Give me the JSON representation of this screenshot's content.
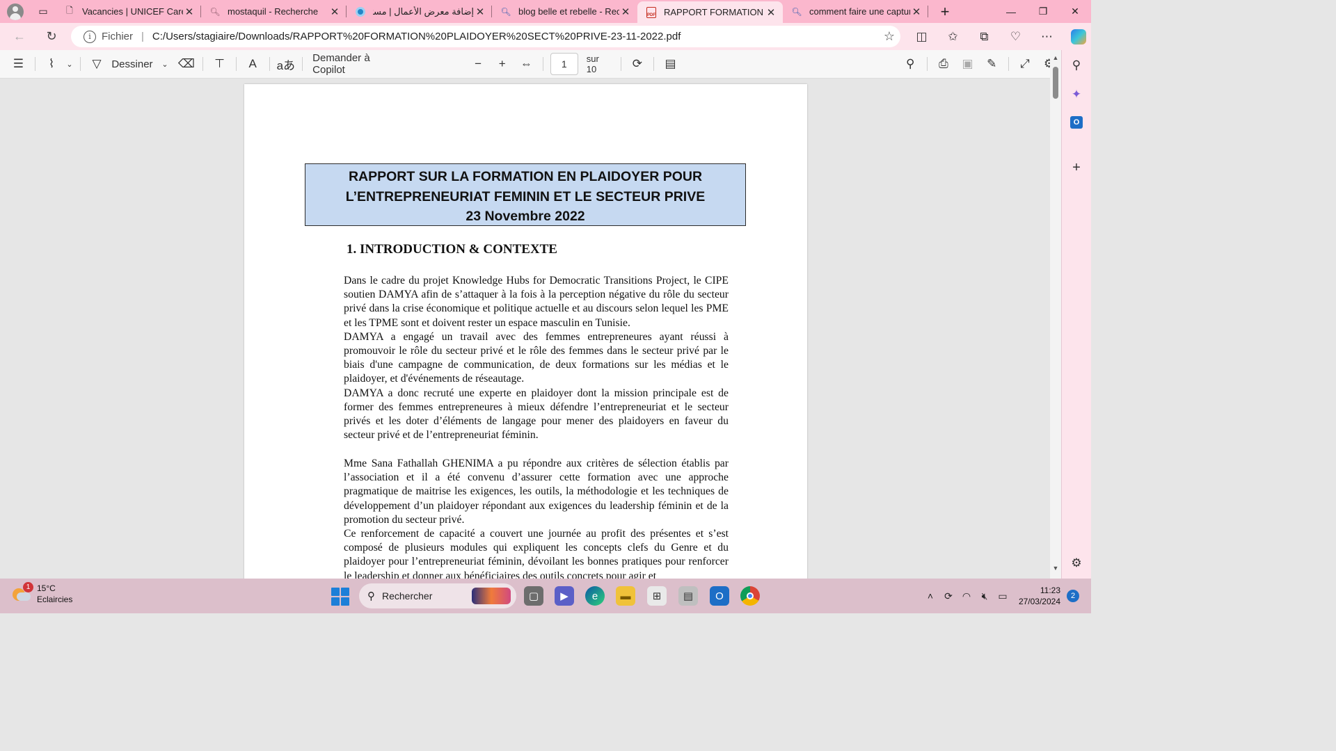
{
  "browser": {
    "tabs": [
      {
        "title": "Vacancies | UNICEF Careers",
        "icon": "page-icon",
        "active": false
      },
      {
        "title": "mostaquil - Recherche",
        "icon": "search-icon",
        "active": false
      },
      {
        "title": "إضافة معرض الأعمال | مستقل",
        "icon": "mostaql-icon",
        "active": false
      },
      {
        "title": "blog belle et rebelle - Recherche",
        "icon": "search-icon",
        "active": false
      },
      {
        "title": "RAPPORT FORMATION PLAIDOYER",
        "icon": "pdf-icon",
        "active": true
      },
      {
        "title": "comment faire une capture",
        "icon": "search-icon",
        "active": false
      }
    ],
    "address": {
      "scheme_label": "Fichier",
      "url": "C:/Users/stagiaire/Downloads/RAPPORT%20FORMATION%20PLAIDOYER%20SECT%20PRIVE-23-11-2022.pdf"
    }
  },
  "pdf_toolbar": {
    "draw_label": "Dessiner",
    "copilot_label": "Demander à Copilot",
    "page_value": "1",
    "page_total": "sur 10"
  },
  "document": {
    "title_lines": [
      "RAPPORT SUR LA FORMATION EN PLAIDOYER POUR",
      "L’ENTREPRENEURIAT FEMININ ET LE SECTEUR PRIVE",
      "23 Novembre 2022"
    ],
    "heading": "1.  INTRODUCTION & CONTEXTE",
    "paragraphs_block1": [
      "Dans le cadre du projet Knowledge Hubs for Democratic Transitions Project, le CIPE soutien DAMYA afin de s’attaquer à la fois à la perception négative du rôle du secteur privé dans la crise économique et politique actuelle et au discours selon lequel les PME et les TPME sont et doivent rester un espace masculin en Tunisie.",
      "DAMYA a engagé un travail avec des femmes entrepreneures ayant réussi à promouvoir le rôle du secteur privé et le rôle des femmes dans le secteur privé par le biais d'une campagne de communication, de deux formations sur les médias et le plaidoyer, et d'événements de réseautage.",
      "DAMYA a donc recruté une experte en plaidoyer dont la mission principale est de former des femmes entrepreneures à mieux défendre l’entrepreneuriat et le secteur privés et les doter d’éléments de langage pour mener des plaidoyers en faveur du secteur privé et de l’entrepreneuriat féminin."
    ],
    "paragraphs_block2": [
      "Mme Sana Fathallah GHENIMA a pu répondre aux critères de sélection établis par l’association et il a été convenu d’assurer cette formation avec une approche pragmatique de maitrise les exigences, les outils, la méthodologie et les techniques de développement d’un plaidoyer répondant aux exigences du leadership féminin et de la promotion du secteur privé.",
      "Ce renforcement de capacité a couvert une journée au profit des présentes et s’est composé de plusieurs modules qui expliquent les concepts clefs du Genre et du plaidoyer pour l’entrepreneuriat féminin, dévoilant les bonnes pratiques pour renforcer le leadership et donner aux bénéficiaires des outils concrets pour agir et"
    ]
  },
  "taskbar": {
    "weather_temp": "15°C",
    "weather_desc": "Eclaircies",
    "weather_badge": "1",
    "search_label": "Rechercher",
    "time": "11:23",
    "date": "27/03/2024",
    "notifications": "2"
  },
  "colors": {
    "tabstrip": "#fbb7cd",
    "title_box": "#c6d9f1",
    "taskbar": "#dcbfcb"
  }
}
